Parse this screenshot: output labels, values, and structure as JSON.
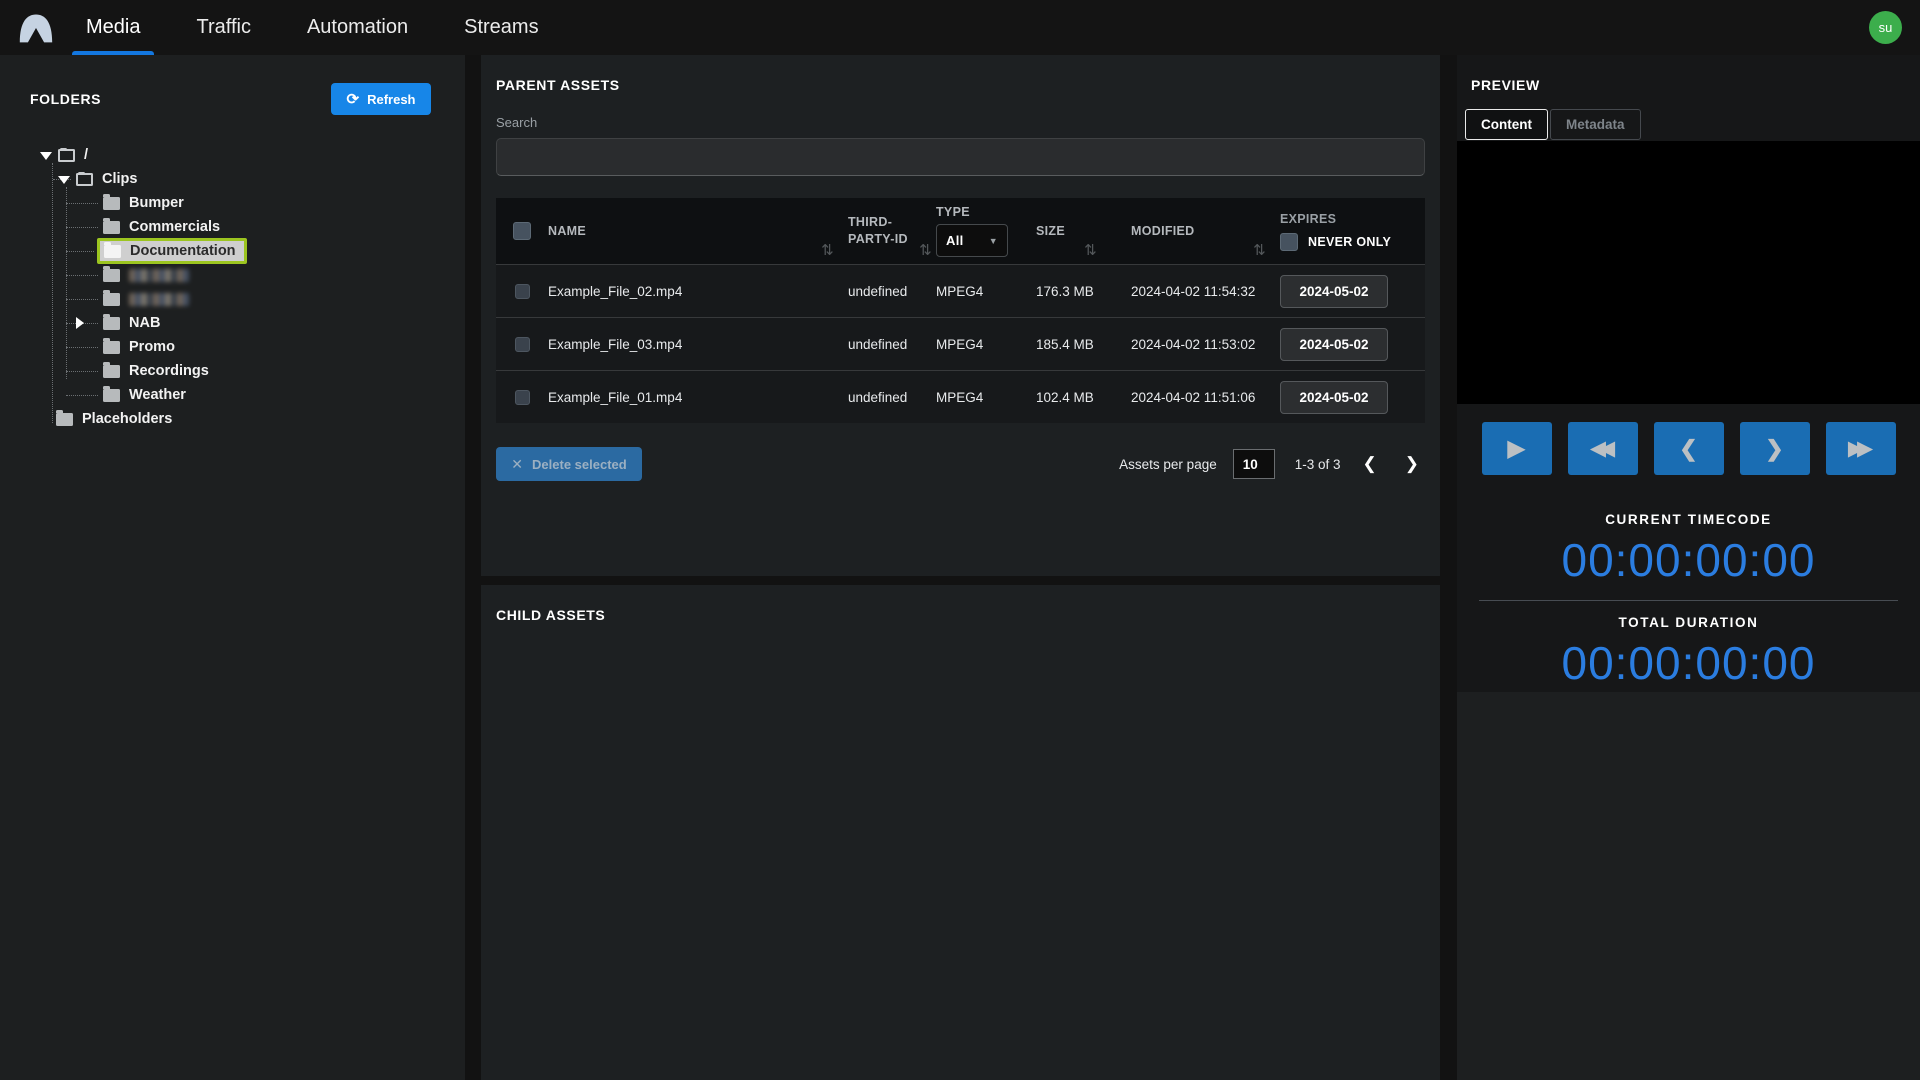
{
  "nav": {
    "tabs": [
      {
        "label": "Media",
        "active": true
      },
      {
        "label": "Traffic",
        "active": false
      },
      {
        "label": "Automation",
        "active": false
      },
      {
        "label": "Streams",
        "active": false
      }
    ],
    "avatar_initials": "su"
  },
  "icons": {
    "refresh": "⟳",
    "sort": "⇅",
    "caret_down": "▼",
    "delete_x": "✕",
    "chevron_left": "❮",
    "chevron_right": "❯",
    "play": "▶",
    "rewind": "◀◀",
    "step_back": "❮",
    "step_forward": "❯",
    "fast_forward": "▶▶"
  },
  "folders": {
    "title": "FOLDERS",
    "refresh_label": "Refresh",
    "tree": [
      {
        "label": "/",
        "depth": 0,
        "state": "expanded"
      },
      {
        "label": "Clips",
        "depth": 1,
        "state": "expanded"
      },
      {
        "label": "Bumper",
        "depth": 2
      },
      {
        "label": "Commercials",
        "depth": 2
      },
      {
        "label": "Documentation",
        "depth": 2,
        "selected": true
      },
      {
        "label": "",
        "depth": 2,
        "redacted": true
      },
      {
        "label": "",
        "depth": 2,
        "redacted": true
      },
      {
        "label": "NAB",
        "depth": 2,
        "state": "collapsed"
      },
      {
        "label": "Promo",
        "depth": 2
      },
      {
        "label": "Recordings",
        "depth": 2
      },
      {
        "label": "Weather",
        "depth": 2
      },
      {
        "label": "Placeholders",
        "depth": 0
      }
    ]
  },
  "parent_assets": {
    "title": "PARENT ASSETS",
    "search_label": "Search",
    "columns": {
      "name": "NAME",
      "third_party": "THIRD-PARTY-ID",
      "type": "TYPE",
      "type_filter_value": "All",
      "size": "SIZE",
      "modified": "MODIFIED",
      "expires": "EXPIRES",
      "never_only": "NEVER ONLY"
    },
    "rows": [
      {
        "name": "Example_File_02.mp4",
        "third_party_id": "undefined",
        "type": "MPEG4",
        "size": "176.3 MB",
        "modified": "2024-04-02 11:54:32",
        "expires": "2024-05-02"
      },
      {
        "name": "Example_File_03.mp4",
        "third_party_id": "undefined",
        "type": "MPEG4",
        "size": "185.4 MB",
        "modified": "2024-04-02 11:53:02",
        "expires": "2024-05-02"
      },
      {
        "name": "Example_File_01.mp4",
        "third_party_id": "undefined",
        "type": "MPEG4",
        "size": "102.4 MB",
        "modified": "2024-04-02 11:51:06",
        "expires": "2024-05-02"
      }
    ],
    "footer": {
      "delete_label": "Delete selected",
      "per_page_label": "Assets per page",
      "per_page_value": "10",
      "range": "1-3 of 3"
    }
  },
  "child_assets": {
    "title": "CHILD ASSETS"
  },
  "preview": {
    "title": "PREVIEW",
    "tabs": [
      {
        "label": "Content",
        "active": true
      },
      {
        "label": "Metadata",
        "active": false
      }
    ],
    "current_timecode_label": "CURRENT TIMECODE",
    "current_timecode": "00:00:00:00",
    "total_duration_label": "TOTAL DURATION",
    "total_duration": "00:00:00:00"
  },
  "colors": {
    "accent_blue": "#1786e8",
    "transport_blue": "#1a6db3",
    "timecode_blue": "#2b7de0",
    "selection_green": "#9cc520",
    "avatar_green": "#3cae4c"
  }
}
